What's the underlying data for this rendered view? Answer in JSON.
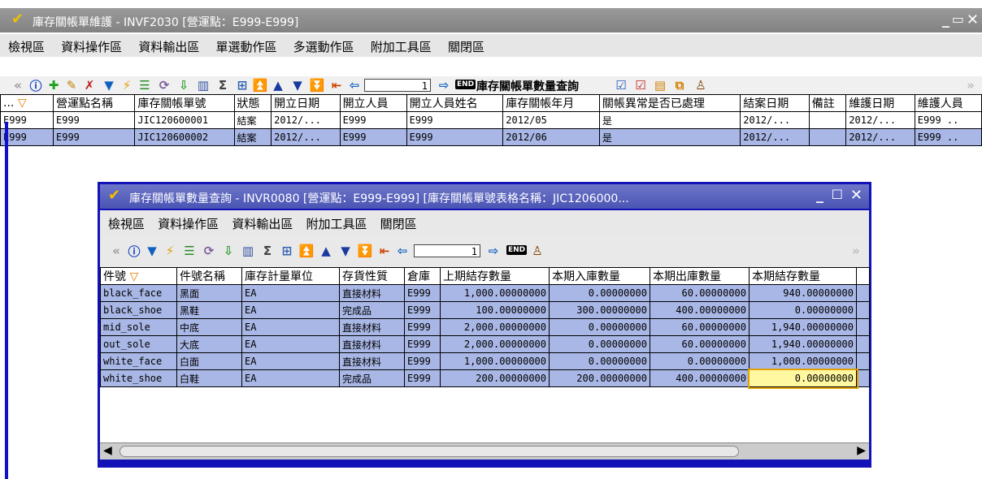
{
  "main": {
    "title": "庫存關帳單維護 - INVF2030 [營運點：E999-E999]",
    "menus": [
      "檢視區",
      "資料操作區",
      "資料輸出區",
      "單選動作區",
      "多選動作區",
      "附加工具區",
      "關閉區"
    ],
    "toolbar": {
      "page": "1",
      "query_label": "庫存關帳單數量查詢",
      "end_label": "END"
    },
    "columns": [
      "...",
      "營運點名稱",
      "庫存關帳單號",
      "狀態",
      "開立日期",
      "開立人員",
      "開立人員姓名",
      "庫存關帳年月",
      "關帳異常是否已處理",
      "結案日期",
      "備註",
      "維護日期",
      "維護人員"
    ],
    "rows": [
      [
        "E999",
        "E999",
        "JIC120600001",
        "結案",
        "2012/...",
        "E999",
        "E999",
        "2012/05",
        "是",
        "2012/...",
        "",
        "2012/...",
        "E999 .."
      ],
      [
        "E999",
        "E999",
        "JIC120600002",
        "結案",
        "2012/...",
        "E999",
        "E999",
        "2012/06",
        "是",
        "2012/...",
        "",
        "2012/...",
        "E999 .."
      ]
    ]
  },
  "child": {
    "title": "庫存關帳單數量查詢 - INVR0080 [營運點：E999-E999] [庫存關帳單號表格名稱：JIC1206000...",
    "menus": [
      "檢視區",
      "資料操作區",
      "資料輸出區",
      "附加工具區",
      "關閉區"
    ],
    "toolbar": {
      "page": "1",
      "end_label": "END"
    },
    "columns": [
      "件號",
      "件號名稱",
      "庫存計量單位",
      "存貨性質",
      "倉庫",
      "上期結存數量",
      "本期入庫數量",
      "本期出庫數量",
      "本期結存數量"
    ],
    "rows": [
      [
        "black_face",
        "黑面",
        "EA",
        "直接材料",
        "E999",
        "1,000.00000000",
        "0.00000000",
        "60.00000000",
        "940.00000000"
      ],
      [
        "black_shoe",
        "黑鞋",
        "EA",
        "完成品",
        "E999",
        "100.00000000",
        "300.00000000",
        "400.00000000",
        "0.00000000"
      ],
      [
        "mid_sole",
        "中底",
        "EA",
        "直接材料",
        "E999",
        "2,000.00000000",
        "0.00000000",
        "60.00000000",
        "1,940.00000000"
      ],
      [
        "out_sole",
        "大底",
        "EA",
        "直接材料",
        "E999",
        "2,000.00000000",
        "0.00000000",
        "60.00000000",
        "1,940.00000000"
      ],
      [
        "white_face",
        "白面",
        "EA",
        "直接材料",
        "E999",
        "1,000.00000000",
        "0.00000000",
        "0.00000000",
        "1,000.00000000"
      ],
      [
        "white_shoe",
        "白鞋",
        "EA",
        "完成品",
        "E999",
        "200.00000000",
        "200.00000000",
        "400.00000000",
        "0.00000000"
      ]
    ]
  },
  "colors": {
    "accent": "#1212b8",
    "selected_row": "#a9b7e6",
    "title_gray": "#8c8c8c",
    "child_title": "#5560bc",
    "highlight_cell": "#fff8a0"
  }
}
